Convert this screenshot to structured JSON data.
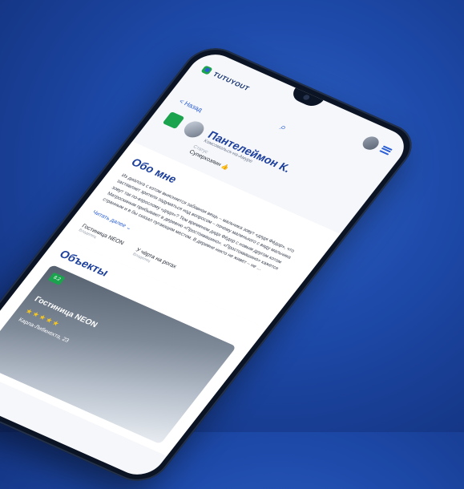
{
  "header": {
    "brand": "TUTUYOUT",
    "search_icon": "search-icon"
  },
  "nav": {
    "back": "< Назад"
  },
  "profile": {
    "name": "Пантелеймон К.",
    "city": "Комсомольск-на-Амуре",
    "status_label": "Статус",
    "status_value": "Суперхозяин 👍"
  },
  "about": {
    "title": "Обо мне",
    "text": "Из диалога с котом выясняется забавная вещь – мальчика зовут «дядя Фёдор», что заставляет зрителя задуматься над вопросом – почему маленького с виду мальчика зовут так по-взрослому «дядя»? Тем временем дядя Фёдор с новым другом котом Матроскиным прибывают в деревню «Простоквашино». «Простоквашино» кажется странным и в бы сказал пугающим местом. В деревне никто не живет – не …",
    "read_more": "Читать далее ⌄"
  },
  "owned_objects": [
    {
      "name": "Гостиница NEON",
      "role": "Владелец"
    },
    {
      "name": "У чёрта на рогах",
      "role": "Владелец"
    }
  ],
  "objects": {
    "title": "Объекты",
    "card": {
      "rating": "8.2",
      "title": "Гостиница NEON",
      "stars": "★★★★★",
      "address": "Карла-Либкнехта, 23"
    }
  },
  "colors": {
    "accent": "#2b5fd6",
    "brand_green": "#1ba34d",
    "background": "#1d49a8"
  }
}
